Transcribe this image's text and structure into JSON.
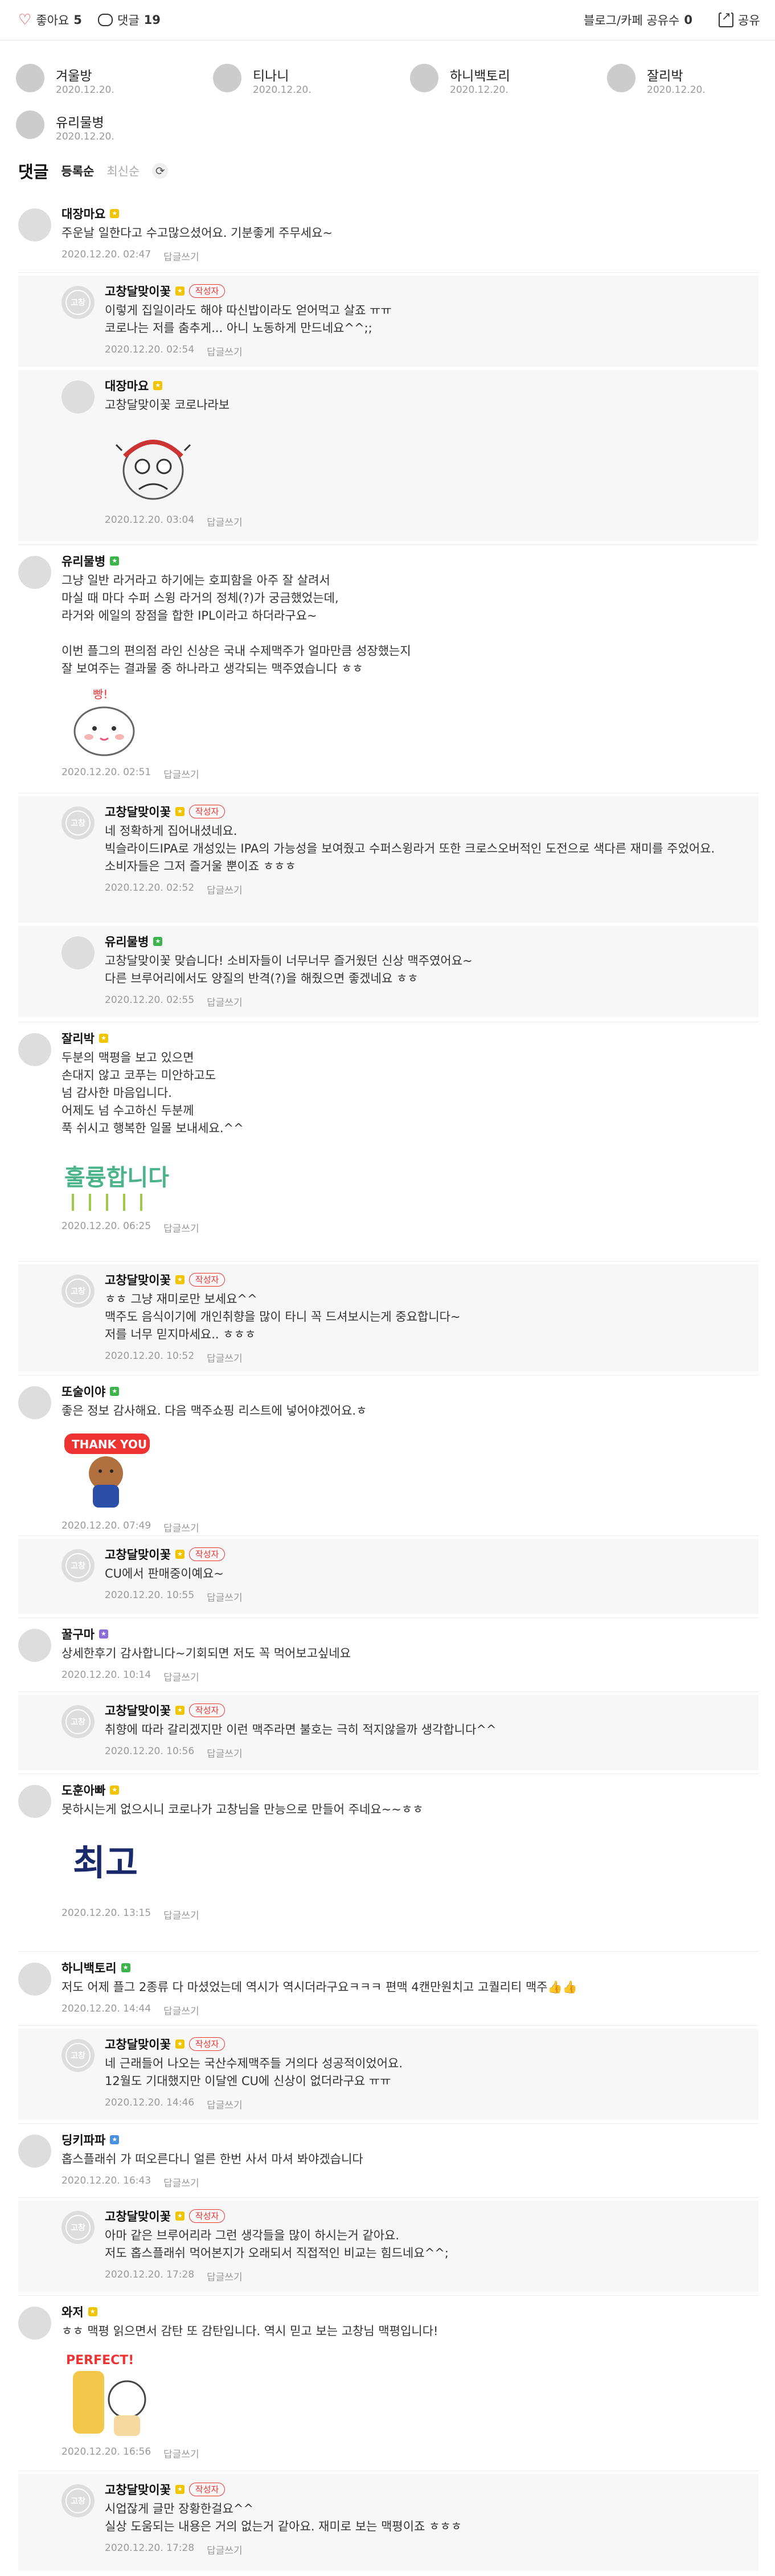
{
  "topbar": {
    "like_label": "좋아요",
    "like_count": "5",
    "comment_label": "댓글",
    "comment_count": "19",
    "share_label": "블로그/카페 공유수",
    "share_count": "0",
    "share_button": "공유"
  },
  "likers": [
    {
      "name": "겨울방",
      "date": "2020.12.20."
    },
    {
      "name": "티나니",
      "date": "2020.12.20."
    },
    {
      "name": "하니백토리",
      "date": "2020.12.20."
    },
    {
      "name": "잘리박",
      "date": "2020.12.20."
    },
    {
      "name": "유리물병",
      "date": "2020.12.20."
    }
  ],
  "comment_header": {
    "title": "댓글",
    "sort_active": "등록순",
    "sort_inactive": "최신순",
    "refresh_icon": "refresh-icon"
  },
  "writer_badge": "작성자",
  "reply_label": "답글쓰기",
  "comments": [
    {
      "name": "대장마요",
      "level": "yellow",
      "text": "주운날 일한다고 수고많으셨어요. 기분좋게 주무세요~",
      "date": "2020.12.20. 02:47"
    },
    {
      "name": "고창달맞이꽃",
      "level": "yellow",
      "text": "이렇게 집일이라도 해야 따신밥이라도 얻어먹고 살죠 ㅠㅠ\n코로나는 저를 춤추게... 아니 노동하게 만드네요^^;;",
      "date": "2020.12.20. 02:54"
    },
    {
      "name": "대장마요",
      "level": "yellow",
      "text": "고창달맞이꽃 코로나라보",
      "date": "2020.12.20. 03:04"
    },
    {
      "name": "유리물병",
      "level": "green",
      "text": "그냥 일반 라거라고 하기에는 호피함을 아주 잘 살려서\n마실 때 마다 수퍼 스윙 라거의 정체(?)가 궁금했었는데,\n라거와 에일의 장점을 합한 IPL이라고 하더라구요~\n\n이번 플그의 편의점 라인 신상은 국내 수제맥주가 얼마만큼 성장했는지\n잘 보여주는 결과물 중 하나라고 생각되는 맥주였습니다 ㅎㅎ",
      "date": "2020.12.20. 02:51"
    },
    {
      "name": "고창달맞이꽃",
      "level": "yellow",
      "text": "네 정확하게 집어내셨네요.\n빅슬라이드IPA로 개성있는 IPA의 가능성을 보여줬고 수퍼스윙라거 또한 크로스오버적인 도전으로 색다른 재미를 주었어요.\n소비자들은 그저 즐거울 뿐이죠 ㅎㅎㅎ",
      "date": "2020.12.20. 02:52"
    },
    {
      "name": "유리물병",
      "level": "green",
      "text": "고창달맞이꽃 맞습니다! 소비자들이 너무너무 즐거웠던 신상 맥주였어요~\n다른 브루어리에서도 양질의 반격(?)을 해줬으면 좋겠네요 ㅎㅎ",
      "date": "2020.12.20. 02:55"
    },
    {
      "name": "잘리박",
      "level": "yellow",
      "text": "두분의 맥평을 보고 있으면\n손대지 않고 코푸는 미안하고도\n넘 감사한 마음입니다.\n어제도 넘 수고하신 두분께\n푹 쉬시고 행복한 일몰 보내세요.^^",
      "date": "2020.12.20. 06:25"
    },
    {
      "name": "고창달맞이꽃",
      "level": "yellow",
      "text": "ㅎㅎ 그냥 재미로만 보세요^^\n맥주도 음식이기에 개인취향을 많이 타니 꼭 드셔보시는게 중요합니다~\n저를 너무 믿지마세요.. ㅎㅎㅎ",
      "date": "2020.12.20. 10:52"
    },
    {
      "name": "또술이야",
      "level": "green",
      "text": "좋은 정보 감사해요. 다음 맥주쇼핑 리스트에 넣어야겠어요.ㅎ",
      "date": "2020.12.20. 07:49"
    },
    {
      "name": "고창달맞이꽃",
      "level": "yellow",
      "text": "CU에서 판매중이예요~",
      "date": "2020.12.20. 10:55"
    },
    {
      "name": "꿀구마",
      "level": "purple",
      "text": "상세한후기 감사합니다~기회되면 저도 꼭 먹어보고싶네요",
      "date": "2020.12.20. 10:14"
    },
    {
      "name": "고창달맞이꽃",
      "level": "yellow",
      "text": "취향에 따라 갈리겠지만 이런 맥주라면 불호는 극히 적지않을까 생각합니다^^",
      "date": "2020.12.20. 10:56"
    },
    {
      "name": "도훈아빠",
      "level": "yellow",
      "text": "못하시는게 없으시니 코로나가 고창님을 만능으로 만들어 주네요~~ㅎㅎ",
      "date": "2020.12.20. 13:15"
    },
    {
      "name": "하니백토리",
      "level": "green",
      "text": "저도 어제 플그 2종류 다 마셨었는데 역시가 역시더라구요ㅋㅋㅋ 편맥 4캔만원치고 고퀄리티 맥주👍👍",
      "date": "2020.12.20. 14:44"
    },
    {
      "name": "고창달맞이꽃",
      "level": "yellow",
      "text": "네 근래들어 나오는 국산수제맥주들 거의다 성공적이었어요.\n12월도 기대했지만 이달엔 CU에 신상이 없더라구요 ㅠㅠ",
      "date": "2020.12.20. 14:46"
    },
    {
      "name": "딩키파파",
      "level": "blue",
      "text": "홉스플래쉬 가 떠오른다니 얼른 한번 사서 마셔 봐야겠습니다",
      "date": "2020.12.20. 16:43"
    },
    {
      "name": "고창달맞이꽃",
      "level": "yellow",
      "text": "아마 같은 브루어리라 그런 생각들을 많이 하시는거 같아요.\n저도 홉스플래쉬 먹어본지가 오래되서 직접적인 비교는 힘드네요^^;",
      "date": "2020.12.20. 17:28"
    },
    {
      "name": "와저",
      "level": "yellow",
      "text": "ㅎㅎ 맥평 읽으면서 감탄 또 감탄입니다. 역시 믿고 보는 고창님 맥평입니다!",
      "date": "2020.12.20. 16:56"
    },
    {
      "name": "고창달맞이꽃",
      "level": "yellow",
      "text": "시업잖게 글만 장황한걸요^^\n실상 도움되는 내용은 거의 없는거 같아요. 재미로 보는 맥평이죠 ㅎㅎㅎ",
      "date": "2020.12.20. 17:28"
    }
  ],
  "stickers": {
    "thank_you": "THANK YOU",
    "yumgood": "훌륭합니다",
    "best": "최고",
    "perfect": "PERFECT!",
    "bang": "빵!"
  }
}
